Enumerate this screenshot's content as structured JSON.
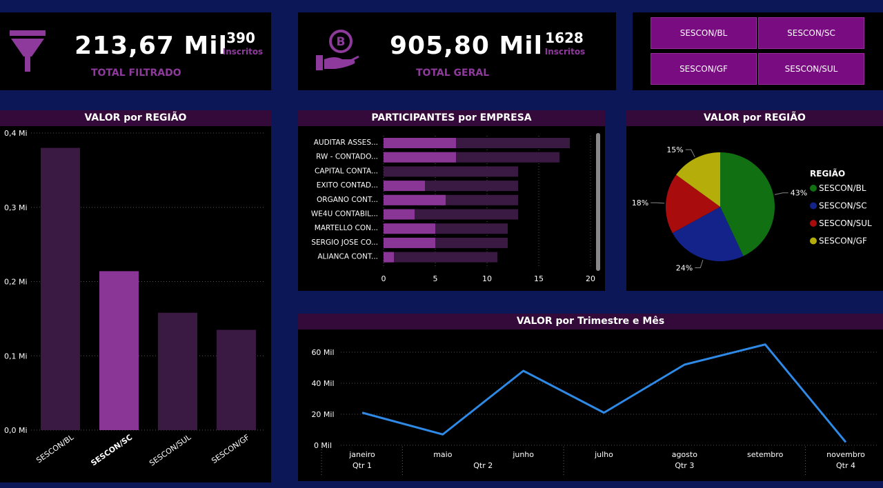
{
  "kpi_filtered": {
    "value": "213,67 Mil",
    "label": "TOTAL FILTRADO",
    "count": "390",
    "count_label": "Inscritos"
  },
  "kpi_total": {
    "value": "905,80 Mil",
    "label": "TOTAL GERAL",
    "count": "1628",
    "count_label": "Inscritos"
  },
  "slicer": {
    "buttons": [
      "SESCON/BL",
      "SESCON/SC",
      "SESCON/GF",
      "SESCON/SUL"
    ]
  },
  "colors": {
    "background": "#0c1758",
    "panel": "#000000",
    "title_bar": "#340a3b",
    "accent_purple": "#8e3a9c",
    "bar_dark": "#3a1a42",
    "bar_selected": "#8a3696",
    "line_blue": "#2e8ae6",
    "pie_green": "#117011",
    "pie_blue": "#14238a",
    "pie_red": "#a80c0c",
    "pie_yellow": "#b4ad0a"
  },
  "chart_data": [
    {
      "type": "bar",
      "title": "VALOR por REGIÃO",
      "categories": [
        "SESCON/BL",
        "SESCON/SC",
        "SESCON/SUL",
        "SESCON/GF"
      ],
      "values": [
        0.38,
        0.214,
        0.158,
        0.135
      ],
      "selected_category": "SESCON/SC",
      "yticks": [
        "0,4 Mi",
        "0,3 Mi",
        "0,2 Mi",
        "0,1 Mi",
        "0,0 Mi"
      ],
      "ylim": [
        0,
        0.4
      ],
      "grid": true
    },
    {
      "type": "bar",
      "orientation": "horizontal",
      "title": "PARTICIPANTES por EMPRESA",
      "categories": [
        "AUDITAR ASSES...",
        "RW - CONTADO...",
        "CAPITAL CONTA...",
        "EXITO CONTAD...",
        "ORGANO CONT...",
        "WE4U CONTABIL...",
        "MARTELLO CON...",
        "SERGIO JOSE CO...",
        "ALIANCA CONT..."
      ],
      "series": [
        {
          "values": [
            18,
            17,
            13,
            13,
            13,
            13,
            12,
            12,
            11
          ]
        },
        {
          "values": [
            7,
            7,
            0,
            4,
            6,
            3,
            5,
            5,
            1
          ]
        }
      ],
      "xticks": [
        "0",
        "5",
        "10",
        "15",
        "20"
      ],
      "xlim": [
        0,
        20
      ]
    },
    {
      "type": "pie",
      "title": "VALOR por REGIÃO",
      "legend_title": "REGIÃO",
      "legend_position": "right",
      "slices": [
        {
          "name": "SESCON/BL",
          "value": 43,
          "label": "43%"
        },
        {
          "name": "SESCON/SC",
          "value": 24,
          "label": "24%"
        },
        {
          "name": "SESCON/SUL",
          "value": 18,
          "label": "18%"
        },
        {
          "name": "SESCON/GF",
          "value": 15,
          "label": "15%"
        }
      ]
    },
    {
      "type": "line",
      "title": "VALOR por Trimestre e Mês",
      "x": [
        "janeiro",
        "maio",
        "junho",
        "julho",
        "agosto",
        "setembro",
        "novembro"
      ],
      "quarters": [
        {
          "label": "Qtr 1",
          "months": [
            "janeiro"
          ]
        },
        {
          "label": "Qtr 2",
          "months": [
            "maio",
            "junho"
          ]
        },
        {
          "label": "Qtr 3",
          "months": [
            "julho",
            "agosto",
            "setembro"
          ]
        },
        {
          "label": "Qtr 4",
          "months": [
            "novembro"
          ]
        }
      ],
      "values": [
        21,
        7,
        48,
        21,
        52,
        65,
        2
      ],
      "yticks": [
        "60 Mil",
        "40 Mil",
        "20 Mil",
        "0 Mil"
      ],
      "ylim": [
        0,
        60
      ],
      "grid": true
    }
  ]
}
